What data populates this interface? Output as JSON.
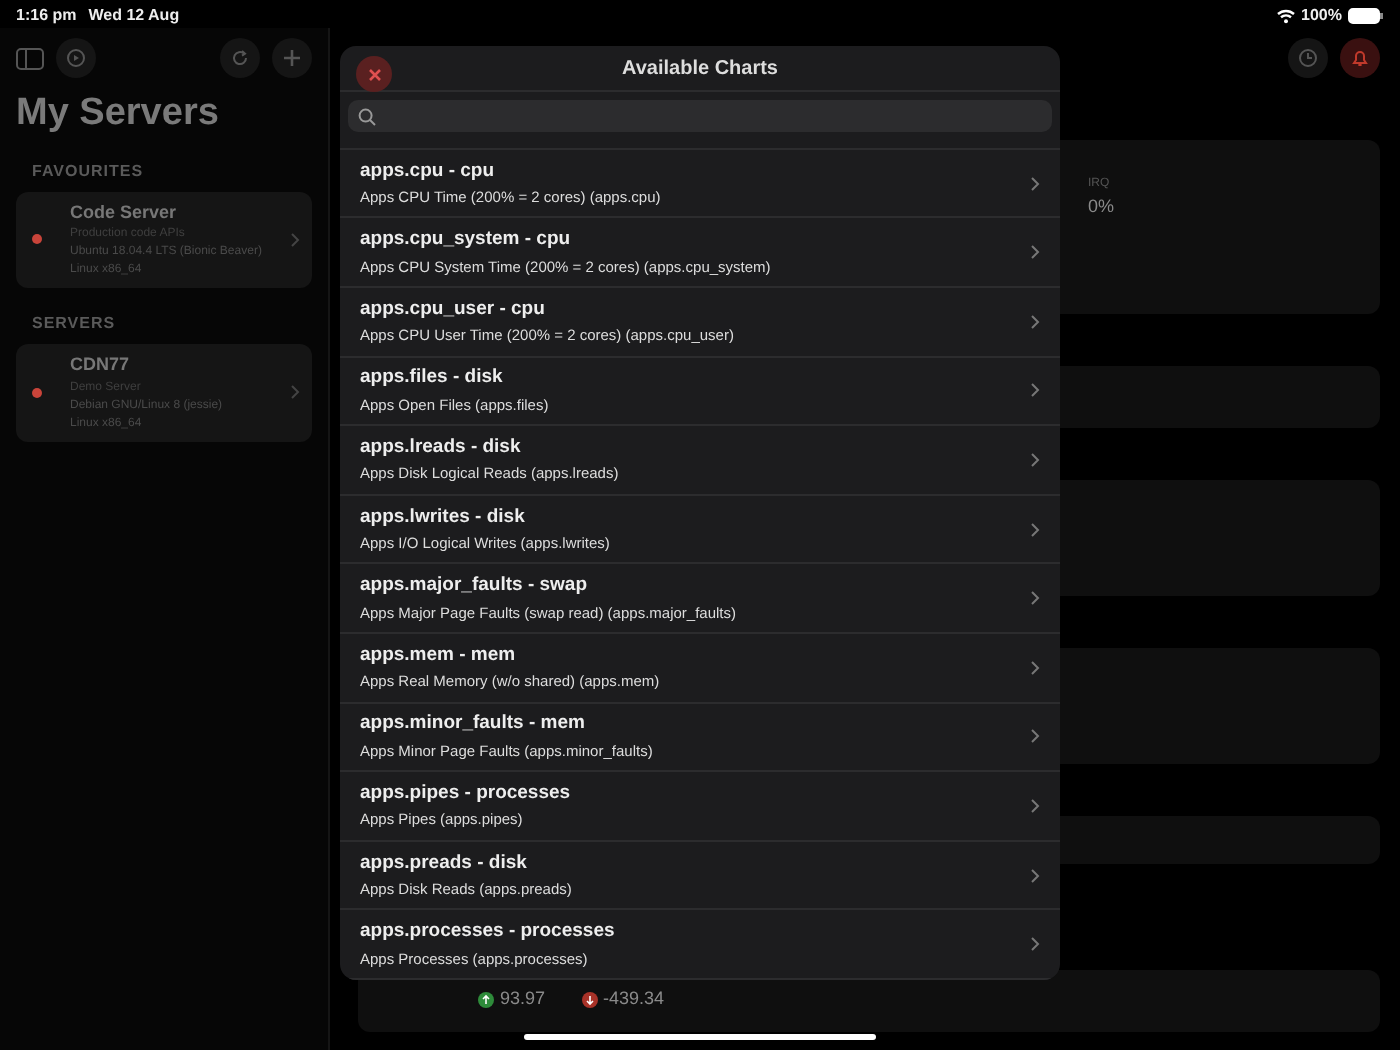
{
  "status_bar": {
    "time": "1:16 pm",
    "date": "Wed 12 Aug",
    "battery": "100%"
  },
  "sidebar": {
    "title": "My Servers",
    "sections": [
      {
        "heading": "FAVOURITES",
        "servers": [
          {
            "name": "Code Server",
            "description": "Production code APIs",
            "os": "Ubuntu 18.04.4 LTS (Bionic Beaver)",
            "arch": "Linux x86_64",
            "color": "#c9443a"
          }
        ]
      },
      {
        "heading": "SERVERS",
        "servers": [
          {
            "name": "CDN77",
            "description": "Demo Server",
            "os": "Debian GNU/Linux 8 (jessie)",
            "arch": "Linux x86_64",
            "color": "#c9443a"
          }
        ]
      }
    ]
  },
  "main": {
    "metric": {
      "label": "IRQ",
      "value": "0%"
    },
    "totals": [
      {
        "kind": "up",
        "value": "93.97"
      },
      {
        "kind": "down",
        "value": "-439.34"
      }
    ]
  },
  "modal": {
    "title": "Available Charts",
    "items": [
      {
        "title": "apps.cpu - cpu",
        "subtitle": "Apps CPU Time (200% = 2 cores) (apps.cpu)"
      },
      {
        "title": "apps.cpu_system - cpu",
        "subtitle": "Apps CPU System Time (200% = 2 cores) (apps.cpu_system)"
      },
      {
        "title": "apps.cpu_user - cpu",
        "subtitle": "Apps CPU User Time (200% = 2 cores) (apps.cpu_user)"
      },
      {
        "title": "apps.files - disk",
        "subtitle": "Apps Open Files (apps.files)"
      },
      {
        "title": "apps.lreads - disk",
        "subtitle": "Apps Disk Logical Reads (apps.lreads)"
      },
      {
        "title": "apps.lwrites - disk",
        "subtitle": "Apps I/O Logical Writes (apps.lwrites)"
      },
      {
        "title": "apps.major_faults - swap",
        "subtitle": "Apps Major Page Faults (swap read) (apps.major_faults)"
      },
      {
        "title": "apps.mem - mem",
        "subtitle": "Apps Real Memory (w/o shared) (apps.mem)"
      },
      {
        "title": "apps.minor_faults - mem",
        "subtitle": "Apps Minor Page Faults (apps.minor_faults)"
      },
      {
        "title": "apps.pipes - processes",
        "subtitle": "Apps Pipes (apps.pipes)"
      },
      {
        "title": "apps.preads - disk",
        "subtitle": "Apps Disk Reads (apps.preads)"
      },
      {
        "title": "apps.processes - processes",
        "subtitle": "Apps Processes (apps.processes)"
      }
    ]
  }
}
